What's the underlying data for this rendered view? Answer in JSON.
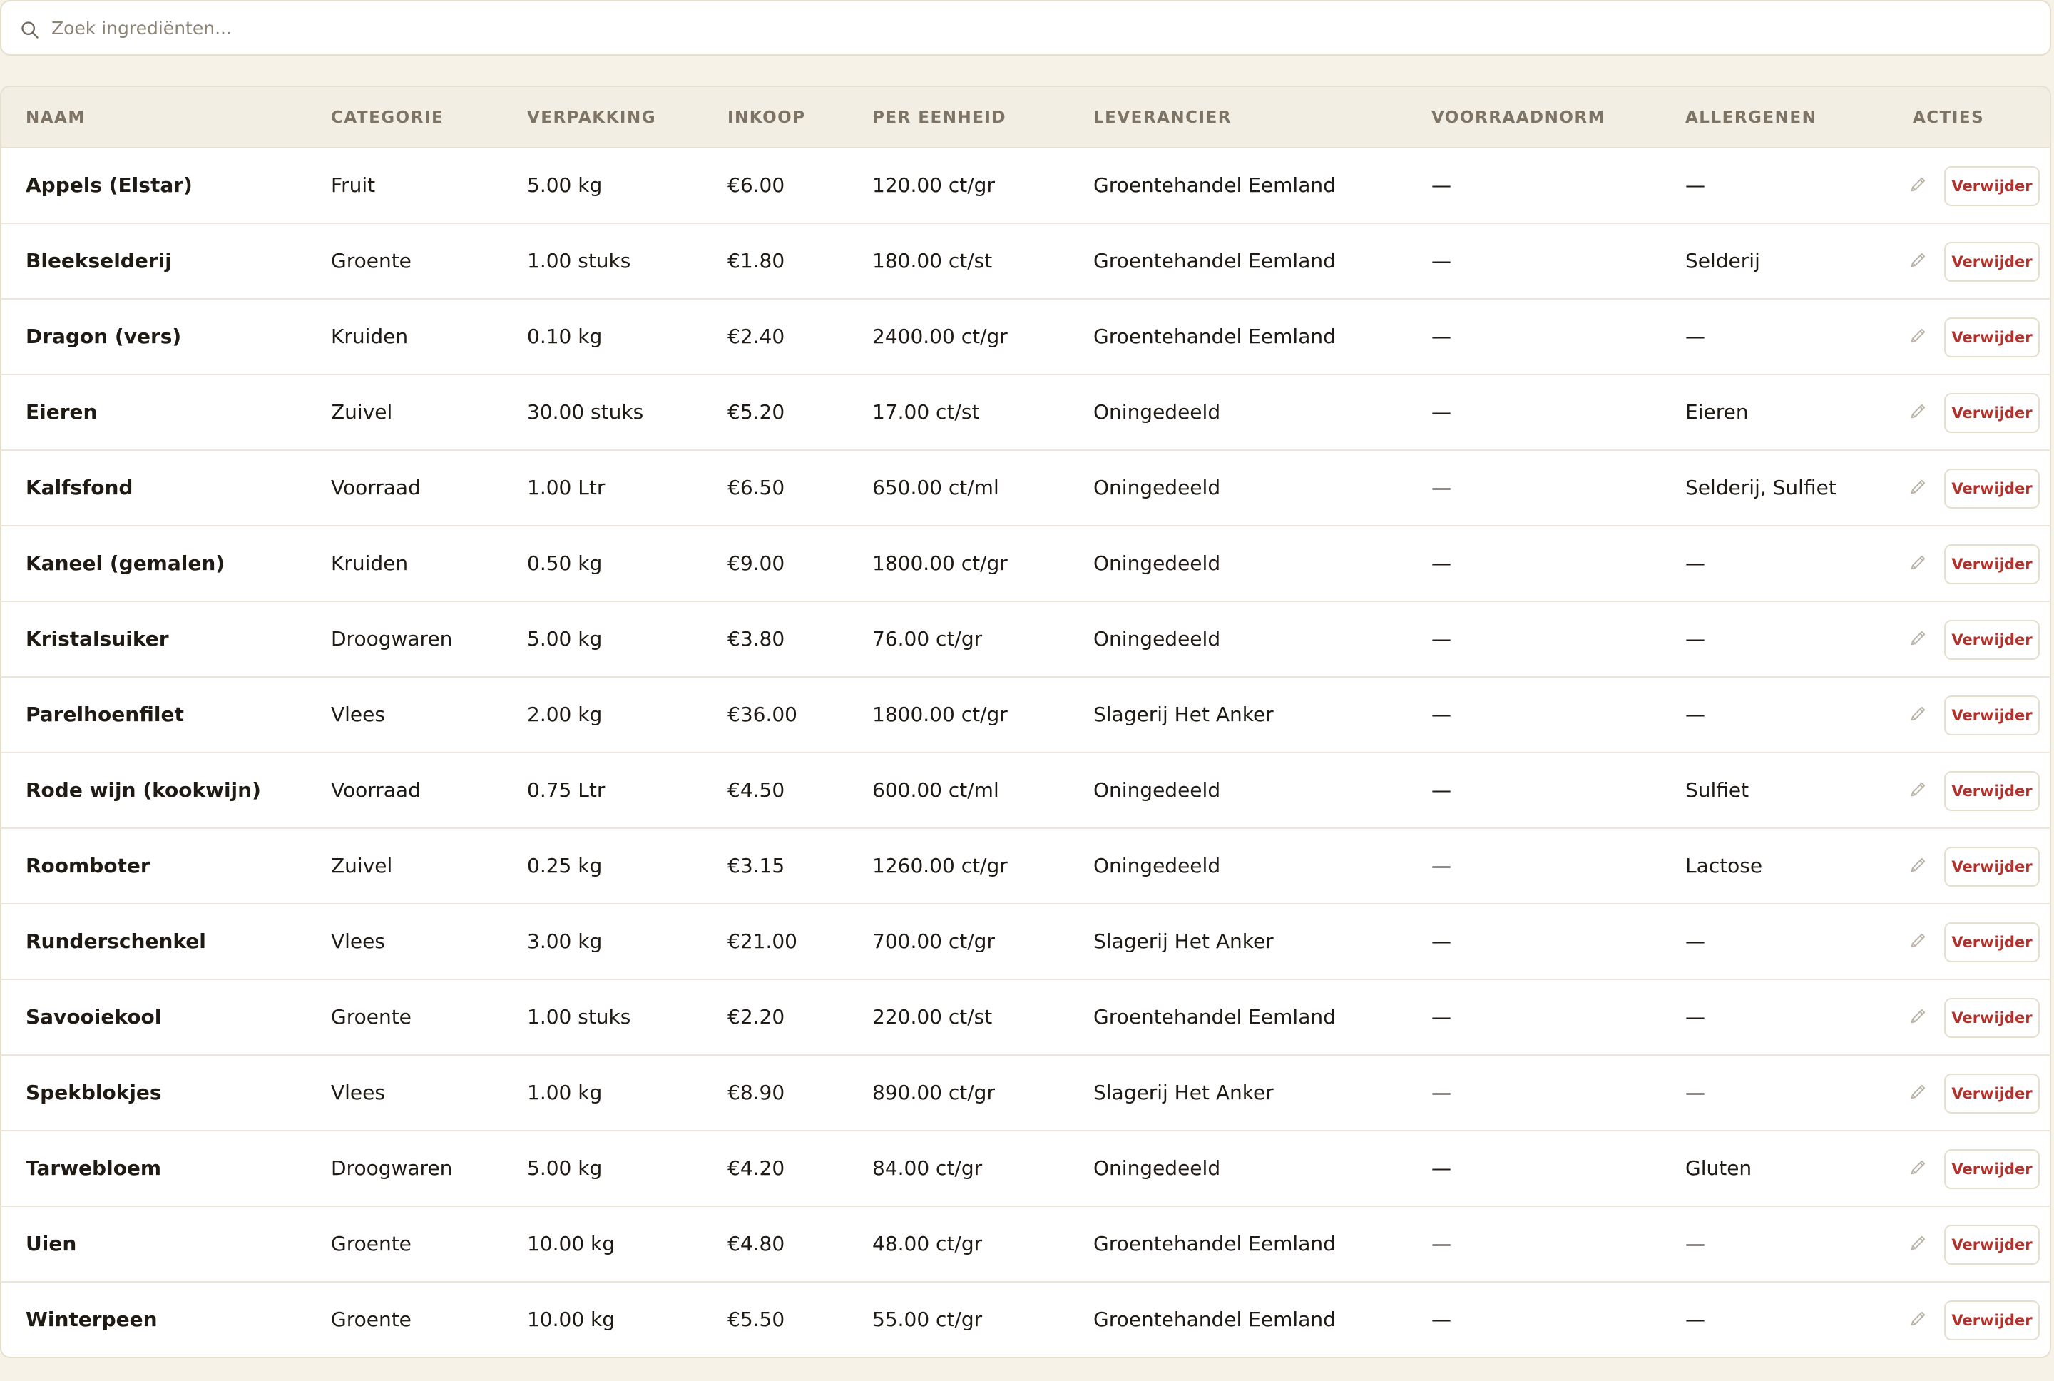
{
  "search": {
    "placeholder": "Zoek ingrediënten...",
    "value": "",
    "icon": "search-icon"
  },
  "table": {
    "columns": [
      "NAAM",
      "CATEGORIE",
      "VERPAKKING",
      "INKOOP",
      "PER EENHEID",
      "LEVERANCIER",
      "VOORRAADNORM",
      "ALLERGENEN",
      "ACTIES"
    ],
    "rows": [
      {
        "naam": "Appels (Elstar)",
        "categorie": "Fruit",
        "verpakking": "5.00 kg",
        "inkoop": "€6.00",
        "per_eenheid": "120.00 ct/gr",
        "leverancier": "Groentehandel Eemland",
        "voorraadnorm": "—",
        "allergenen": "—"
      },
      {
        "naam": "Bleekselderij",
        "categorie": "Groente",
        "verpakking": "1.00 stuks",
        "inkoop": "€1.80",
        "per_eenheid": "180.00 ct/st",
        "leverancier": "Groentehandel Eemland",
        "voorraadnorm": "—",
        "allergenen": "Selderij"
      },
      {
        "naam": "Dragon (vers)",
        "categorie": "Kruiden",
        "verpakking": "0.10 kg",
        "inkoop": "€2.40",
        "per_eenheid": "2400.00 ct/gr",
        "leverancier": "Groentehandel Eemland",
        "voorraadnorm": "—",
        "allergenen": "—"
      },
      {
        "naam": "Eieren",
        "categorie": "Zuivel",
        "verpakking": "30.00 stuks",
        "inkoop": "€5.20",
        "per_eenheid": "17.00 ct/st",
        "leverancier": "Oningedeeld",
        "voorraadnorm": "—",
        "allergenen": "Eieren"
      },
      {
        "naam": "Kalfsfond",
        "categorie": "Voorraad",
        "verpakking": "1.00 Ltr",
        "inkoop": "€6.50",
        "per_eenheid": "650.00 ct/ml",
        "leverancier": "Oningedeeld",
        "voorraadnorm": "—",
        "allergenen": "Selderij, Sulfiet"
      },
      {
        "naam": "Kaneel (gemalen)",
        "categorie": "Kruiden",
        "verpakking": "0.50 kg",
        "inkoop": "€9.00",
        "per_eenheid": "1800.00 ct/gr",
        "leverancier": "Oningedeeld",
        "voorraadnorm": "—",
        "allergenen": "—"
      },
      {
        "naam": "Kristalsuiker",
        "categorie": "Droogwaren",
        "verpakking": "5.00 kg",
        "inkoop": "€3.80",
        "per_eenheid": "76.00 ct/gr",
        "leverancier": "Oningedeeld",
        "voorraadnorm": "—",
        "allergenen": "—"
      },
      {
        "naam": "Parelhoenfilet",
        "categorie": "Vlees",
        "verpakking": "2.00 kg",
        "inkoop": "€36.00",
        "per_eenheid": "1800.00 ct/gr",
        "leverancier": "Slagerij Het Anker",
        "voorraadnorm": "—",
        "allergenen": "—"
      },
      {
        "naam": "Rode wijn (kookwijn)",
        "categorie": "Voorraad",
        "verpakking": "0.75 Ltr",
        "inkoop": "€4.50",
        "per_eenheid": "600.00 ct/ml",
        "leverancier": "Oningedeeld",
        "voorraadnorm": "—",
        "allergenen": "Sulfiet"
      },
      {
        "naam": "Roomboter",
        "categorie": "Zuivel",
        "verpakking": "0.25 kg",
        "inkoop": "€3.15",
        "per_eenheid": "1260.00 ct/gr",
        "leverancier": "Oningedeeld",
        "voorraadnorm": "—",
        "allergenen": "Lactose"
      },
      {
        "naam": "Runderschenkel",
        "categorie": "Vlees",
        "verpakking": "3.00 kg",
        "inkoop": "€21.00",
        "per_eenheid": "700.00 ct/gr",
        "leverancier": "Slagerij Het Anker",
        "voorraadnorm": "—",
        "allergenen": "—"
      },
      {
        "naam": "Savooiekool",
        "categorie": "Groente",
        "verpakking": "1.00 stuks",
        "inkoop": "€2.20",
        "per_eenheid": "220.00 ct/st",
        "leverancier": "Groentehandel Eemland",
        "voorraadnorm": "—",
        "allergenen": "—"
      },
      {
        "naam": "Spekblokjes",
        "categorie": "Vlees",
        "verpakking": "1.00 kg",
        "inkoop": "€8.90",
        "per_eenheid": "890.00 ct/gr",
        "leverancier": "Slagerij Het Anker",
        "voorraadnorm": "—",
        "allergenen": "—"
      },
      {
        "naam": "Tarwebloem",
        "categorie": "Droogwaren",
        "verpakking": "5.00 kg",
        "inkoop": "€4.20",
        "per_eenheid": "84.00 ct/gr",
        "leverancier": "Oningedeeld",
        "voorraadnorm": "—",
        "allergenen": "Gluten"
      },
      {
        "naam": "Uien",
        "categorie": "Groente",
        "verpakking": "10.00 kg",
        "inkoop": "€4.80",
        "per_eenheid": "48.00 ct/gr",
        "leverancier": "Groentehandel Eemland",
        "voorraadnorm": "—",
        "allergenen": "—"
      },
      {
        "naam": "Winterpeen",
        "categorie": "Groente",
        "verpakking": "10.00 kg",
        "inkoop": "€5.50",
        "per_eenheid": "55.00 ct/gr",
        "leverancier": "Groentehandel Eemland",
        "voorraadnorm": "—",
        "allergenen": "—"
      }
    ],
    "actions": {
      "edit_icon": "pencil-icon",
      "delete_label": "Verwijder"
    }
  },
  "colors": {
    "page_background": "#f6f2e8",
    "header_background": "#f3eee4",
    "border": "#e6dfd0",
    "header_text": "#7d7465",
    "delete_text": "#b3312b"
  }
}
